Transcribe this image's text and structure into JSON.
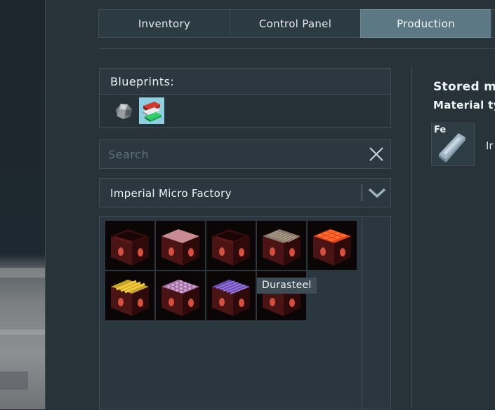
{
  "tabs": [
    {
      "label": "Inventory",
      "active": false
    },
    {
      "label": "Control Panel",
      "active": false
    },
    {
      "label": "Production",
      "active": true
    }
  ],
  "blueprints": {
    "header": "Blueprints:",
    "items": [
      {
        "icon": "ore-chunk-icon",
        "selected": false
      },
      {
        "icon": "ingot-stack-icon",
        "selected": true
      }
    ]
  },
  "search": {
    "placeholder": "Search",
    "value": ""
  },
  "factory_select": {
    "selected": "Imperial Micro Factory"
  },
  "tooltip": "Durasteel",
  "items": [
    {
      "top": "open",
      "color": "#7a1e1e"
    },
    {
      "top": "plain",
      "color": "#c88a93"
    },
    {
      "top": "open",
      "color": "#7a1e1e"
    },
    {
      "top": "ribbed",
      "color": "#8a7a6a"
    },
    {
      "top": "grid",
      "color": "#e0421a"
    },
    {
      "top": "bars",
      "color": "#c8a428"
    },
    {
      "top": "dots",
      "color": "#a877a8"
    },
    {
      "top": "stripes",
      "color": "#6a4db0"
    },
    {
      "top": "plain-dark",
      "color": "#6a1a1a"
    }
  ],
  "stored": {
    "title": "Stored ma",
    "subtitle": "Material ty",
    "materials": [
      {
        "symbol": "Fe",
        "name": "Ir"
      }
    ]
  },
  "colors": {
    "active_tab": "#5c7884",
    "panel_bg": "#273239",
    "border": "#3e4d56",
    "selected_blueprint": "#8ecfe1"
  }
}
